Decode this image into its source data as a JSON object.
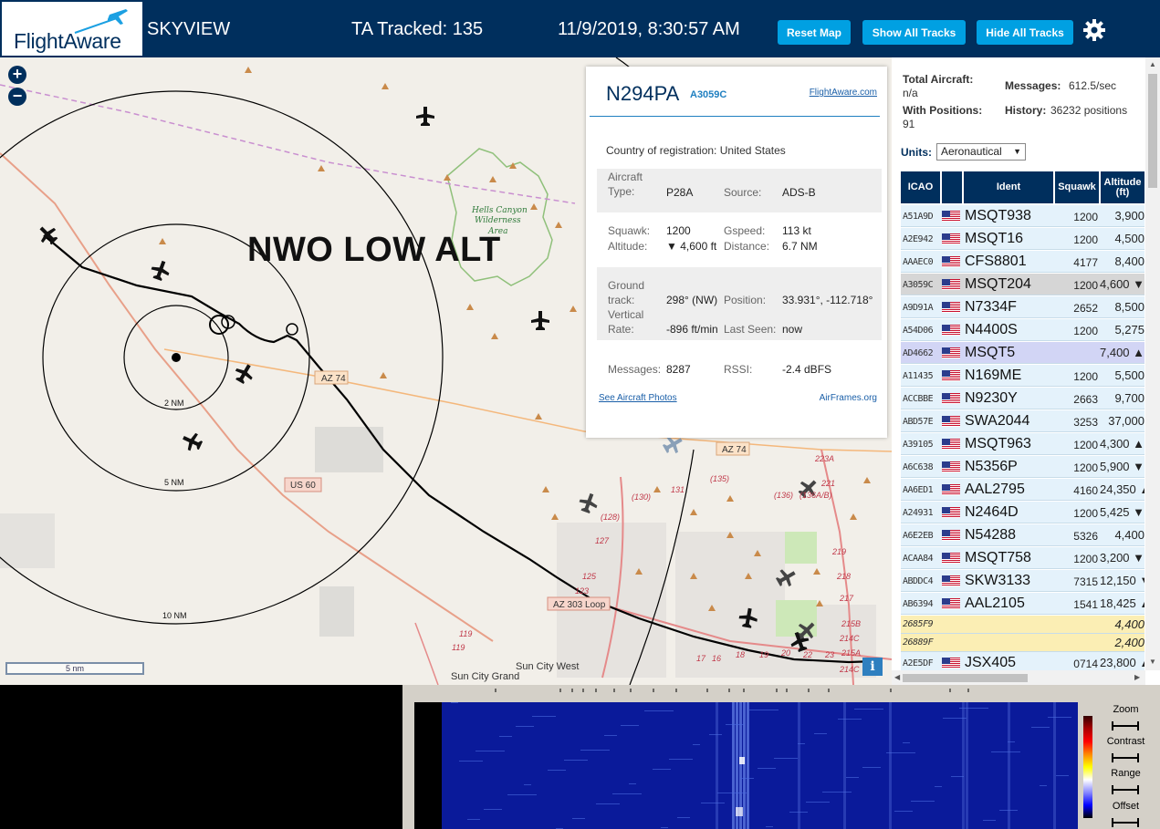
{
  "header": {
    "logo_text": "FlightAware",
    "title": "SKYVIEW",
    "tracked": "TA Tracked: 135",
    "datetime": "11/9/2019, 8:30:57 AM",
    "buttons": {
      "reset": "Reset Map",
      "show_all": "Show All Tracks",
      "hide_all": "Hide All Tracks"
    },
    "settings_icon": "gear-icon",
    "brand_color": "#002f5d",
    "button_color": "#00a0e2"
  },
  "map": {
    "zoom_in": "+",
    "zoom_out": "−",
    "overlay_label": "NWO LOW ALT",
    "ring_labels": [
      "2 NM",
      "5 NM",
      "10 NM"
    ],
    "scale_label": "5 nm",
    "info_label": "i",
    "place_labels": {
      "hells_canyon": [
        "Hells Canyon",
        "Wilderness",
        "Area"
      ],
      "sun_city_grand": "Sun City Grand",
      "sun_city_west": "Sun City West"
    },
    "road_labels": [
      "AZ 74",
      "AZ 74",
      "US 60",
      "AZ 303 Loop"
    ],
    "exit_labels": [
      "(135)",
      "(130)",
      "131",
      "(128)",
      "127",
      "125",
      "123",
      "119",
      "119",
      "(136)",
      "(136A/B)",
      "221",
      "223A",
      "219",
      "218",
      "217",
      "215B",
      "215A",
      "214C",
      "214C",
      "17",
      "16",
      "18",
      "19",
      "20",
      "22",
      "23"
    ]
  },
  "popup": {
    "ident": "N294PA",
    "icao": "A3059C",
    "fa_link": "FlightAware.com",
    "country_label": "Country of registration:",
    "country": "United States",
    "aircraft_type_label": "Aircraft Type:",
    "aircraft_type": "P28A",
    "source_label": "Source:",
    "source": "ADS-B",
    "squawk_label": "Squawk:",
    "squawk": "1200",
    "altitude_label": "Altitude:",
    "altitude": "▼ 4,600 ft",
    "gspeed_label": "Gspeed:",
    "gspeed": "113 kt",
    "distance_label": "Distance:",
    "distance": "6.7 NM",
    "ground_track_label": "Ground track:",
    "ground_track": "298° (NW)",
    "position_label": "Position:",
    "position": "33.931°, -112.718°",
    "vertical_rate_label": "Vertical Rate:",
    "vertical_rate": "-896 ft/min",
    "last_seen_label": "Last Seen:",
    "last_seen": "now",
    "messages_label": "Messages:",
    "messages": "8287",
    "rssi_label": "RSSI:",
    "rssi": "-2.4 dBFS",
    "photos_link": "See Aircraft Photos",
    "airframes_link": "AirFrames.org"
  },
  "stats": {
    "total_label": "Total Aircraft:",
    "total": "n/a",
    "messages_label": "Messages:",
    "messages": "612.5/sec",
    "positions_label": "With Positions:",
    "positions": "91",
    "history_label": "History:",
    "history": "36232 positions",
    "units_label": "Units:",
    "units_value": "Aeronautical"
  },
  "table": {
    "headers": {
      "icao": "ICAO",
      "ident": "Ident",
      "squawk": "Squawk",
      "altitude": "Altitude (ft)"
    },
    "rows": [
      {
        "icao": "A51A9D",
        "ident": "MSQT938",
        "squawk": "1200",
        "alt": "3,900",
        "style": "normal"
      },
      {
        "icao": "A2E942",
        "ident": "MSQT16",
        "squawk": "1200",
        "alt": "4,500",
        "style": "normal"
      },
      {
        "icao": "AAAEC0",
        "ident": "CFS8801",
        "squawk": "4177",
        "alt": "8,400",
        "style": "normal"
      },
      {
        "icao": "A3059C",
        "ident": "MSQT204",
        "squawk": "1200",
        "alt": "4,600 ▼",
        "style": "selected"
      },
      {
        "icao": "A9D91A",
        "ident": "N7334F",
        "squawk": "2652",
        "alt": "8,500",
        "style": "normal"
      },
      {
        "icao": "A54D06",
        "ident": "N4400S",
        "squawk": "1200",
        "alt": "5,275",
        "style": "normal"
      },
      {
        "icao": "AD4662",
        "ident": "MSQT5",
        "squawk": "",
        "alt": "7,400 ▲",
        "style": "highlight"
      },
      {
        "icao": "A11435",
        "ident": "N169ME",
        "squawk": "1200",
        "alt": "5,500",
        "style": "normal"
      },
      {
        "icao": "ACCBBE",
        "ident": "N9230Y",
        "squawk": "2663",
        "alt": "9,700",
        "style": "normal"
      },
      {
        "icao": "ABD57E",
        "ident": "SWA2044",
        "squawk": "3253",
        "alt": "37,000",
        "style": "normal"
      },
      {
        "icao": "A39105",
        "ident": "MSQT963",
        "squawk": "1200",
        "alt": "4,300 ▲",
        "style": "normal"
      },
      {
        "icao": "A6C638",
        "ident": "N5356P",
        "squawk": "1200",
        "alt": "5,900 ▼",
        "style": "normal"
      },
      {
        "icao": "AA6ED1",
        "ident": "AAL2795",
        "squawk": "4160",
        "alt": "24,350 ▲",
        "style": "normal"
      },
      {
        "icao": "A24931",
        "ident": "N2464D",
        "squawk": "1200",
        "alt": "5,425 ▼",
        "style": "normal"
      },
      {
        "icao": "A6E2EB",
        "ident": "N54288",
        "squawk": "5326",
        "alt": "4,400",
        "style": "normal"
      },
      {
        "icao": "ACAA84",
        "ident": "MSQT758",
        "squawk": "1200",
        "alt": "3,200 ▼",
        "style": "normal"
      },
      {
        "icao": "ABDDC4",
        "ident": "SKW3133",
        "squawk": "7315",
        "alt": "12,150 ▼",
        "style": "normal"
      },
      {
        "icao": "AB6394",
        "ident": "AAL2105",
        "squawk": "1541",
        "alt": "18,425 ▲",
        "style": "normal"
      },
      {
        "icao": "2685F9",
        "ident": "",
        "squawk": "",
        "alt": "4,400",
        "style": "yellow"
      },
      {
        "icao": "26889F",
        "ident": "",
        "squawk": "",
        "alt": "2,400",
        "style": "yellow"
      },
      {
        "icao": "A2E5DF",
        "ident": "JSX405",
        "squawk": "0714",
        "alt": "23,800 ▲",
        "style": "normal"
      }
    ]
  },
  "waterfall": {
    "zoom": "Zoom",
    "contrast": "Contrast",
    "range": "Range",
    "offset": "Offset"
  }
}
